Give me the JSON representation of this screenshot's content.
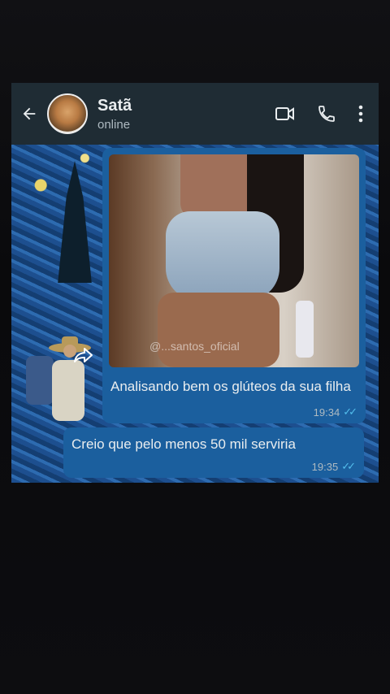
{
  "header": {
    "contact_name": "Satã",
    "status": "online"
  },
  "messages": [
    {
      "text": "Analisando bem os glúteos da sua filha",
      "time": "19:34",
      "image_watermark": "@...santos_oficial"
    },
    {
      "text": "Creio que pelo menos 50 mil serviria",
      "time": "19:35"
    }
  ],
  "icons": {
    "back": "arrow-left-icon",
    "video": "video-camera-icon",
    "call": "phone-icon",
    "menu": "more-vert-icon",
    "forward": "forward-icon",
    "read": "double-check-icon"
  },
  "colors": {
    "topbar": "#1f2c34",
    "bubble": "#1b5f9e",
    "read_ticks": "#53bdeb"
  }
}
